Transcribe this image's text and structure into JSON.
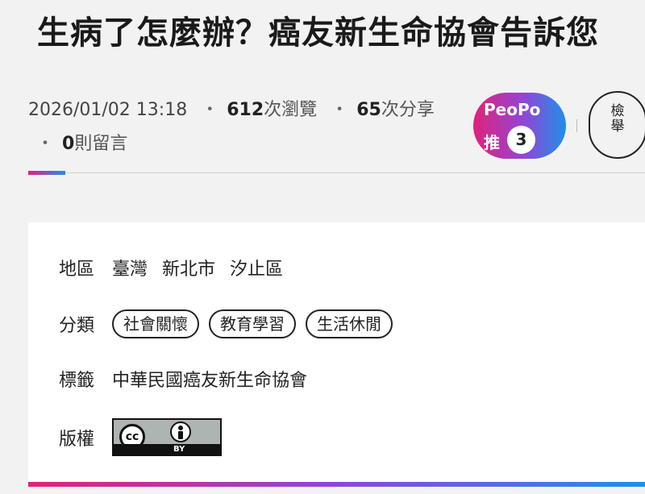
{
  "article": {
    "title": "生病了怎麼辦？癌友新生命協會告訴您"
  },
  "meta": {
    "datetime": "2026/01/02 13:18",
    "views_count": "612",
    "views_label": "次瀏覽",
    "shares_count": "65",
    "shares_label": "次分享",
    "comments_count": "0",
    "comments_label": "則留言",
    "separator": "・"
  },
  "peopo": {
    "brand": "PeoPo",
    "recommend_label": "推",
    "recommend_count": "3"
  },
  "report": {
    "label": "檢舉"
  },
  "info": {
    "region_label": "地區",
    "region_values": [
      "臺灣",
      "新北市",
      "汐止區"
    ],
    "category_label": "分類",
    "categories": [
      "社會關懷",
      "教育學習",
      "生活休閒"
    ],
    "tag_label": "標籤",
    "tag_value": "中華民國癌友新生命協會",
    "license_label": "版權",
    "license_badge_text": "BY",
    "license_icon": "cc-icon"
  },
  "colors": {
    "gradient_start": "#e0227a",
    "gradient_mid": "#9146d6",
    "gradient_end": "#1f8fe8"
  }
}
